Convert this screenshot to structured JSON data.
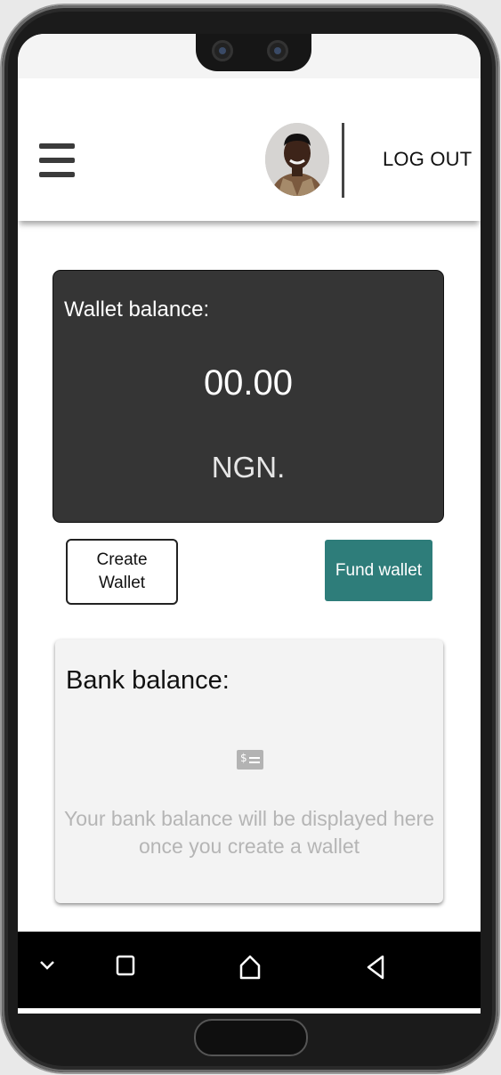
{
  "header": {
    "menu_icon": "hamburger-menu-icon",
    "logout_label": "LOG OUT"
  },
  "wallet": {
    "label": "Wallet balance:",
    "amount": "00.00",
    "currency": "NGN."
  },
  "actions": {
    "create_wallet_label": "Create Wallet",
    "fund_wallet_label": "Fund wallet"
  },
  "bank": {
    "label": "Bank balance:",
    "icon": "money-bill-icon",
    "message": "Your bank balance will be displayed here once you create a wallet"
  },
  "system_nav": {
    "icons": [
      "chevron-down-icon",
      "recent-apps-icon",
      "home-icon",
      "back-icon"
    ]
  },
  "colors": {
    "wallet_card_bg": "#353535",
    "fund_button_bg": "#2e7d7a",
    "bank_card_bg": "#f3f3f3",
    "placeholder_text": "#b5b5b5"
  }
}
